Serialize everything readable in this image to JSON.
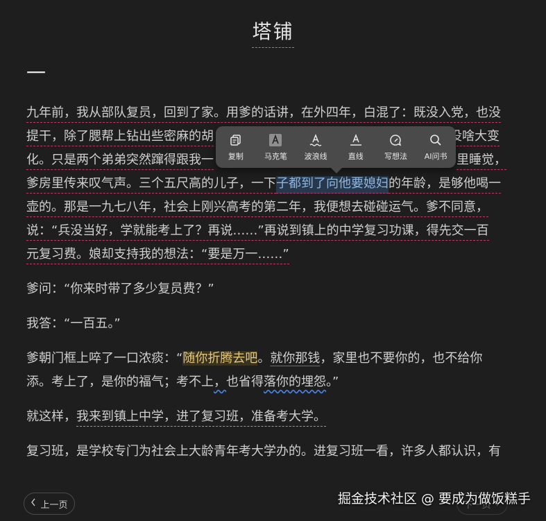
{
  "header": {
    "title": "塔铺",
    "chapter_mark": "一"
  },
  "toolbar": {
    "items": [
      {
        "label": "复制",
        "icon": "copy-icon"
      },
      {
        "label": "马克笔",
        "icon": "marker-icon"
      },
      {
        "label": "波浪线",
        "icon": "wavy-line-icon"
      },
      {
        "label": "直线",
        "icon": "straight-line-icon"
      },
      {
        "label": "写想法",
        "icon": "write-thought-icon"
      },
      {
        "label": "AI问书",
        "icon": "ai-search-icon"
      }
    ]
  },
  "content": {
    "p1": {
      "l1": "九年前，我从部队复员，回到了家。用爹的话讲，在外四年，白混了：既没入党，也没",
      "l2a": "提干，除了腮帮上钻出些密麻的胡",
      "l2b": "没啥大变",
      "l3a": "化。只是两个弟弟突然蹿得跟我一",
      "l3b": "里睡觉，",
      "l4a": "爹房里传来叹气声。三个五尺高的儿子，一下",
      "l4sel": "子都到了向他要媳妇",
      "l4b": "的年龄，是够他喝一",
      "l5": "壶的。那是一九七八年，社会上刚兴高考的第二年，我便想去碰碰运气。爹不同意，",
      "l6": "说：“兵没当好，学就能考上了？再说……”再说到镇上的中学复习功课，得先交一百",
      "l7": "元复习费。娘却支持我的想法：“要是万一……”"
    },
    "p2": "爹问：“你来时带了多少复员费？”",
    "p3": "我答：“一百五。”",
    "p4": {
      "a": "爹朝门框上啐了一口浓痰：“",
      "hl": "随你折腾去吧",
      "b": "。",
      "ul": "就你那钱",
      "c": "，家里也不要你的，也不给你",
      "d": "添。考上了，是你的福气；考不上",
      "w1": "，",
      "e": "也省得",
      "w2": "落你的",
      "f": "埋怨",
      "g": "。”"
    },
    "p5": {
      "a": "就这样，",
      "b": "我来到镇上中学，进了复习班，准备考大学。"
    },
    "p6": "复习班，是学校专门为社会上大龄青年考大学办的。进复习班一看，许多人都认识，有"
  },
  "footer": {
    "prev_label": "上一页",
    "next_label": "下一页",
    "watermark": "掘金技术社区 @ 要成为做饭糕手"
  }
}
